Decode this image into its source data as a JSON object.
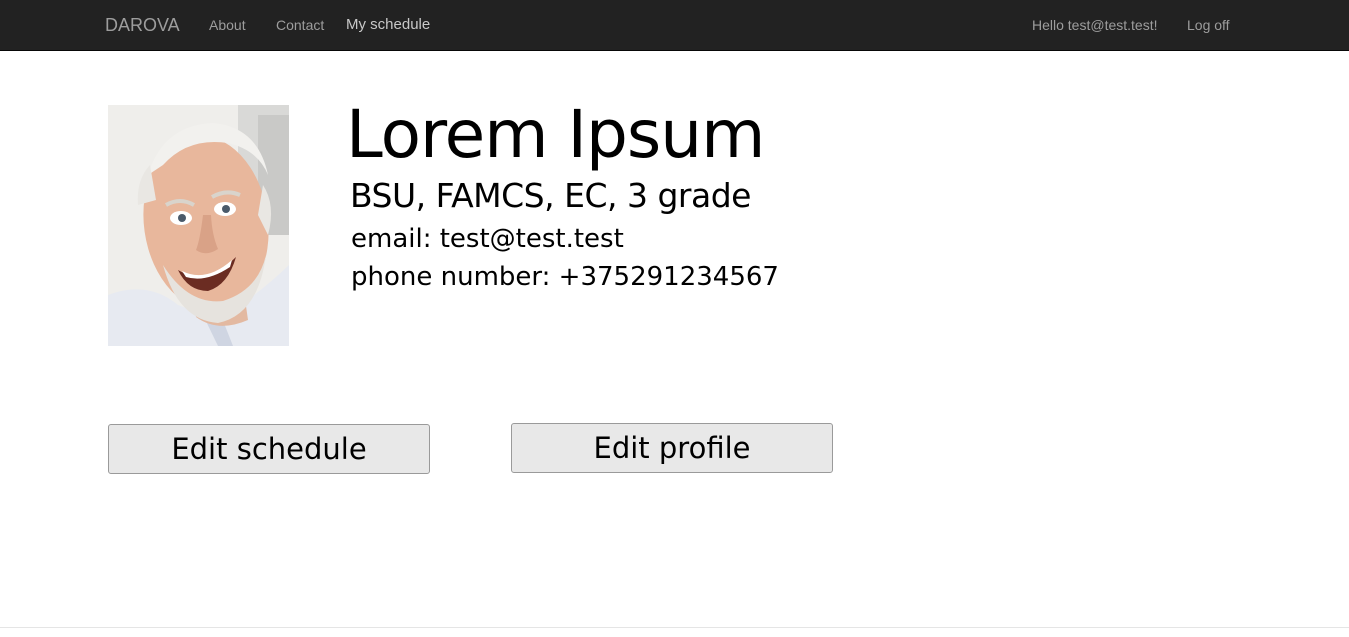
{
  "navbar": {
    "brand": "DAROVA",
    "links": [
      "About",
      "Contact",
      "My schedule"
    ],
    "greeting": "Hello test@test.test!",
    "logoff": "Log off"
  },
  "profile": {
    "name": "Lorem Ipsum",
    "subtitle": "BSU, FAMCS, EC, 3 grade",
    "email": "email: test@test.test",
    "phone": "phone number: +375291234567",
    "photo_icon": "profile-photo"
  },
  "actions": {
    "edit_schedule": "Edit schedule",
    "edit_profile": "Edit profile"
  },
  "colors": {
    "navbar_bg": "#222222",
    "nav_text": "#9d9d9d",
    "button_bg": "#e8e8e8"
  }
}
